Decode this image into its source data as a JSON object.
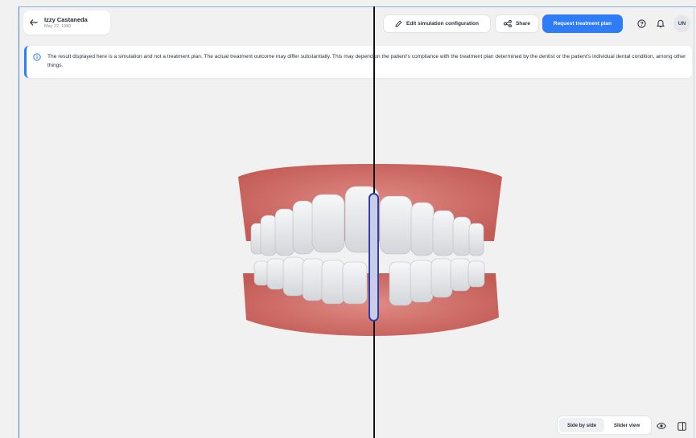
{
  "patient": {
    "name": "Izzy Castaneda",
    "dob": "May 22, 1980"
  },
  "toolbar": {
    "edit_label": "Edit simulation configuration",
    "share_label": "Share",
    "request_label": "Request treatment plan",
    "avatar_initials": "UN"
  },
  "disclaimer": {
    "text": "The result displayed here is a simulation and not a treatment plan. The actual treatment outcome may differ substantially. This may depend on the patient's compliance with the treatment plan determined by the dentist or the patient's individual dental condition, among other things."
  },
  "view_controls": {
    "side_by_side": "Side by side",
    "slider_view": "Slider view",
    "active": "Side by side"
  },
  "colors": {
    "accent": "#2e7cf6",
    "gum": "#d9736d",
    "tooth": "#eceef0",
    "slider_border": "#2b3fa6"
  }
}
